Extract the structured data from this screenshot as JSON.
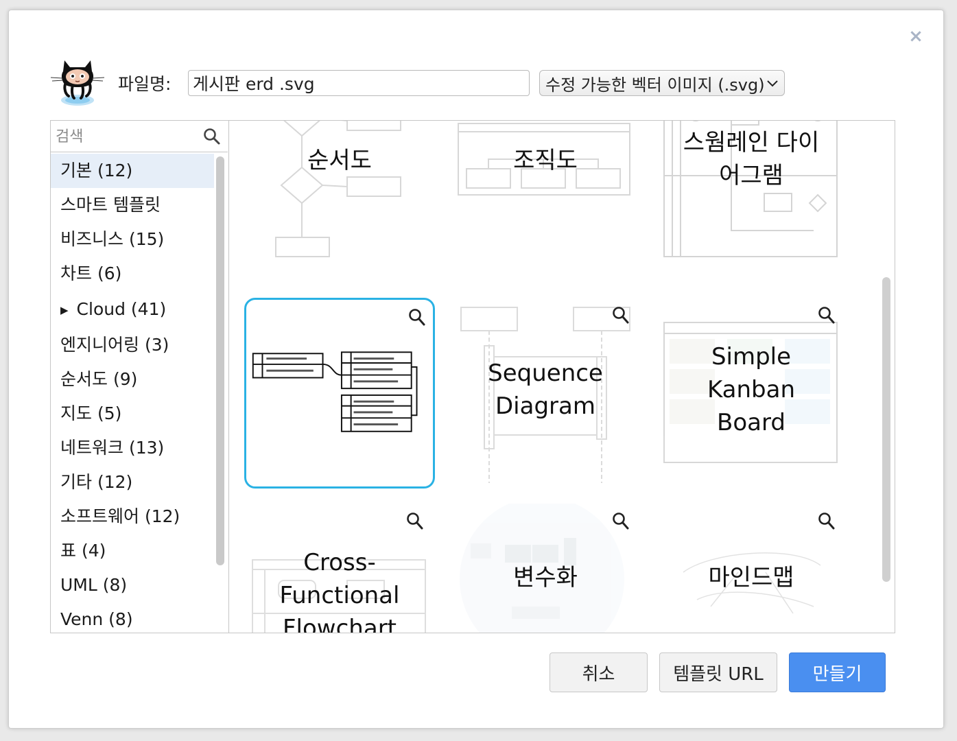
{
  "dialog": {
    "close_symbol": "×",
    "filename_label": "파일명:",
    "filename_value": "게시판 erd .svg",
    "format_value": "수정 가능한 벡터 이미지 (.svg)"
  },
  "search": {
    "placeholder": "검색"
  },
  "categories": [
    {
      "label": "기본 (12)",
      "active": true
    },
    {
      "label": "스마트 템플릿"
    },
    {
      "label": "비즈니스 (15)"
    },
    {
      "label": "차트 (6)"
    },
    {
      "label": "Cloud (41)",
      "collapsible": true
    },
    {
      "label": "엔지니어링 (3)"
    },
    {
      "label": "순서도 (9)"
    },
    {
      "label": "지도 (5)"
    },
    {
      "label": "네트워크 (13)"
    },
    {
      "label": "기타 (12)"
    },
    {
      "label": "소프트웨어 (12)"
    },
    {
      "label": "표 (4)"
    },
    {
      "label": "UML (8)"
    },
    {
      "label": "Venn (8)"
    }
  ],
  "templates": [
    {
      "title": "순서도",
      "thumb": "flowchart"
    },
    {
      "title": "조직도",
      "thumb": "orgchart"
    },
    {
      "title": "스웜레인 다이어그램",
      "title_lines": [
        "스웜레인 다이",
        "어그램"
      ],
      "thumb": "swimlane"
    },
    {
      "title": "",
      "thumb": "erd",
      "selected": true
    },
    {
      "title": "Sequence Diagram",
      "title_lines": [
        "Sequence",
        "Diagram"
      ],
      "thumb": "sequence"
    },
    {
      "title": "Simple Kanban Board",
      "title_lines": [
        "Simple",
        "Kanban",
        "Board"
      ],
      "thumb": "kanban"
    },
    {
      "title": "Cross-Functional Flowchart",
      "title_lines": [
        "Cross-",
        "Functional",
        "Flowchart"
      ],
      "thumb": "crossfunctional"
    },
    {
      "title": "변수화",
      "thumb": "network"
    },
    {
      "title": "마인드맵",
      "thumb": "mindmap"
    }
  ],
  "buttons": {
    "cancel": "취소",
    "template_url": "템플릿 URL",
    "create": "만들기"
  },
  "colors": {
    "accent": "#4a8ff0",
    "selection": "#2ab2e4",
    "active_category": "#e6eef8"
  }
}
